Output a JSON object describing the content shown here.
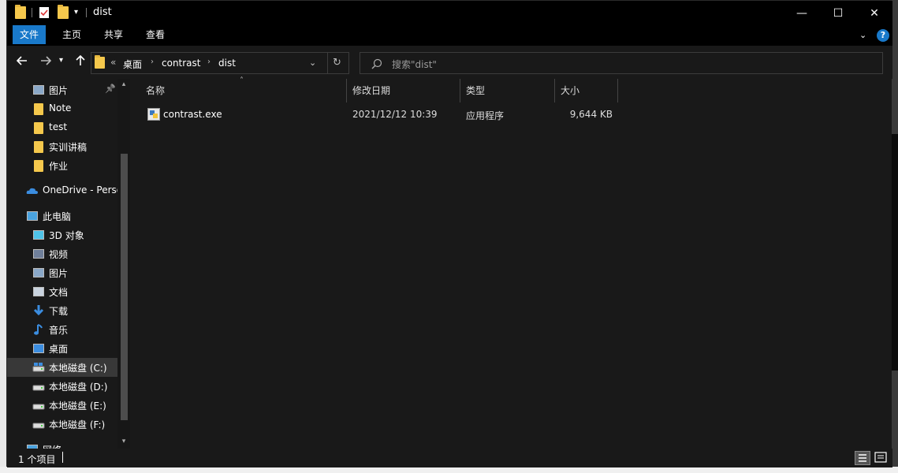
{
  "window": {
    "title": "dist",
    "controls": {
      "minimize": "—",
      "maximize": "☐",
      "close": "✕"
    }
  },
  "ribbon": {
    "tabs": [
      "文件",
      "主页",
      "共享",
      "查看"
    ],
    "help": "?"
  },
  "address": {
    "overflow": "«",
    "crumbs": [
      "桌面",
      "contrast",
      "dist"
    ],
    "search_placeholder": "搜索\"dist\""
  },
  "nav_pane": {
    "items": [
      {
        "label": "图片",
        "icon": "pictures-icon",
        "pinned": true
      },
      {
        "label": "Note",
        "icon": "folder-icon"
      },
      {
        "label": "test",
        "icon": "folder-icon"
      },
      {
        "label": "实训讲稿",
        "icon": "folder-icon"
      },
      {
        "label": "作业",
        "icon": "folder-icon"
      },
      {
        "label": "OneDrive - Perso",
        "icon": "onedrive-icon"
      },
      {
        "label": "此电脑",
        "icon": "this-pc-icon"
      },
      {
        "label": "3D 对象",
        "icon": "3d-objects-icon"
      },
      {
        "label": "视频",
        "icon": "videos-icon"
      },
      {
        "label": "图片",
        "icon": "pictures-icon"
      },
      {
        "label": "文档",
        "icon": "documents-icon"
      },
      {
        "label": "下载",
        "icon": "downloads-icon"
      },
      {
        "label": "音乐",
        "icon": "music-icon"
      },
      {
        "label": "桌面",
        "icon": "desktop-icon"
      },
      {
        "label": "本地磁盘 (C:)",
        "icon": "drive-c-icon",
        "selected": true
      },
      {
        "label": "本地磁盘 (D:)",
        "icon": "drive-icon"
      },
      {
        "label": "本地磁盘 (E:)",
        "icon": "drive-icon"
      },
      {
        "label": "本地磁盘 (F:)",
        "icon": "drive-icon"
      },
      {
        "label": "网络",
        "icon": "network-icon"
      }
    ]
  },
  "file_list": {
    "columns": [
      "名称",
      "修改日期",
      "类型",
      "大小"
    ],
    "rows": [
      {
        "name": "contrast.exe",
        "modified": "2021/12/12 10:39",
        "type": "应用程序",
        "size": "9,644 KB"
      }
    ]
  },
  "status": {
    "item_count": "1 个项目"
  },
  "colors": {
    "accent": "#1979ca",
    "background": "#191919",
    "titlebar": "#000000",
    "folder": "#f5c84c"
  }
}
